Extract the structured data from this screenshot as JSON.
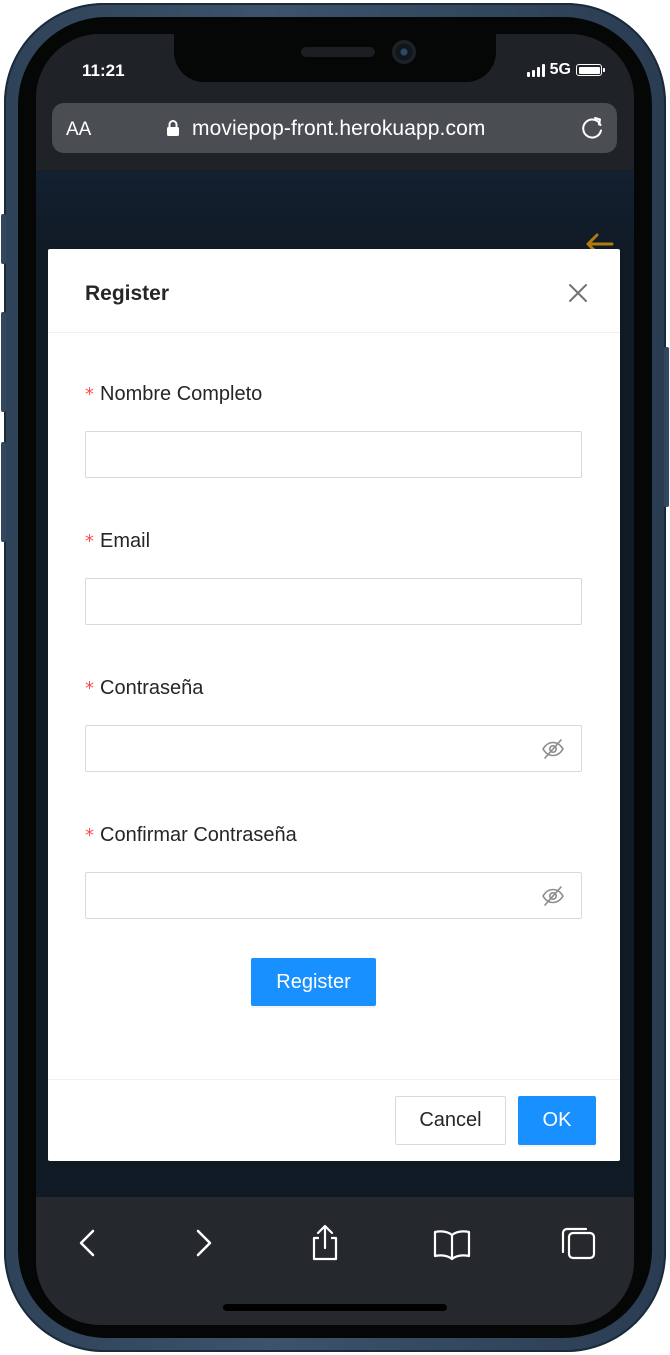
{
  "status_bar": {
    "time": "11:21",
    "network": "5G"
  },
  "browser": {
    "text_size_label": "AA",
    "url": "moviepop-front.herokuapp.com"
  },
  "modal": {
    "title": "Register",
    "fields": [
      {
        "label": "Nombre Completo",
        "required_mark": "*",
        "value": ""
      },
      {
        "label": "Email",
        "required_mark": "*",
        "value": ""
      },
      {
        "label": "Contraseña",
        "required_mark": "*",
        "value": ""
      },
      {
        "label": "Confirmar Contraseña",
        "required_mark": "*",
        "value": ""
      }
    ],
    "submit_label": "Register",
    "cancel_label": "Cancel",
    "ok_label": "OK"
  },
  "colors": {
    "primary": "#1890ff",
    "required": "#ff4d4f",
    "page_background": "#0f1a25",
    "back_arrow": "#b07a10"
  },
  "icons": {
    "status": [
      "signal-icon",
      "battery-icon"
    ],
    "browser": [
      "lock-icon",
      "reload-icon"
    ],
    "modal": [
      "close-icon",
      "eye-invisible-icon"
    ],
    "toolbar": [
      "back-icon",
      "forward-icon",
      "share-icon",
      "bookmarks-icon",
      "tabs-icon"
    ]
  }
}
